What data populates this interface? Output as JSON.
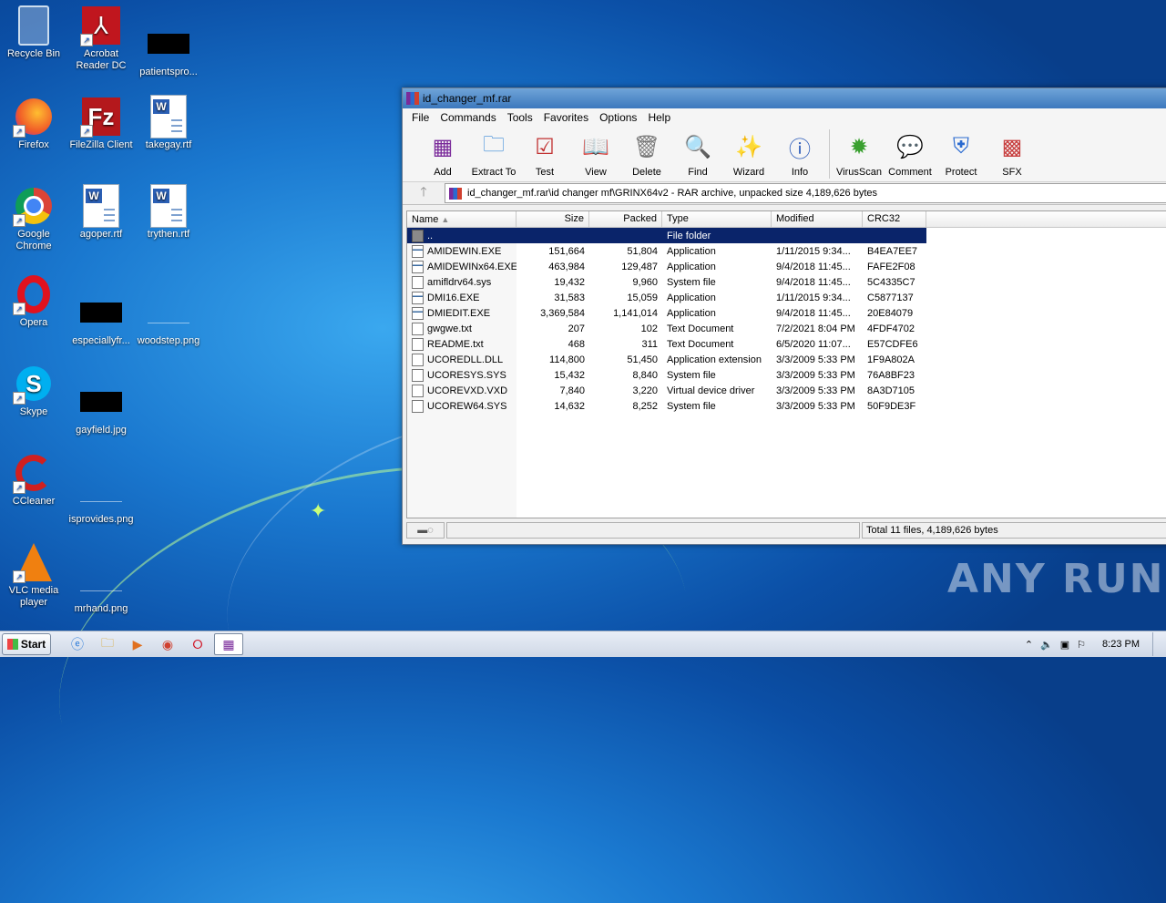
{
  "desktop_icons": [
    {
      "label": "Recycle Bin",
      "icon": "recycle-bin-icon"
    },
    {
      "label": "Acrobat\nReader DC",
      "icon": "acrobat-icon"
    },
    {
      "label": "patientspro...",
      "icon": "redacted-file-icon"
    },
    {
      "label": "Firefox",
      "icon": "firefox-icon"
    },
    {
      "label": "FileZilla Client",
      "icon": "filezilla-icon"
    },
    {
      "label": "takegay.rtf",
      "icon": "word-doc-icon"
    },
    {
      "label": "Google\nChrome",
      "icon": "chrome-icon"
    },
    {
      "label": "agoper.rtf",
      "icon": "word-doc-icon"
    },
    {
      "label": "trythen.rtf",
      "icon": "word-doc-icon"
    },
    {
      "label": "Opera",
      "icon": "opera-icon"
    },
    {
      "label": "especiallyfr...",
      "icon": "redacted-file-icon"
    },
    {
      "label": "woodstep.png",
      "icon": "image-file-icon"
    },
    {
      "label": "Skype",
      "icon": "skype-icon"
    },
    {
      "label": "gayfield.jpg",
      "icon": "redacted-file-icon"
    },
    {
      "label": "CCleaner",
      "icon": "ccleaner-icon"
    },
    {
      "label": "isprovides.png",
      "icon": "image-file-icon"
    },
    {
      "label": "VLC media\nplayer",
      "icon": "vlc-icon"
    },
    {
      "label": "mrhand.png",
      "icon": "image-file-icon"
    }
  ],
  "window": {
    "title": "id_changer_mf.rar",
    "menu": [
      "File",
      "Commands",
      "Tools",
      "Favorites",
      "Options",
      "Help"
    ],
    "toolbar": [
      "Add",
      "Extract To",
      "Test",
      "View",
      "Delete",
      "Find",
      "Wizard",
      "Info",
      "VirusScan",
      "Comment",
      "Protect",
      "SFX"
    ],
    "address": "id_changer_mf.rar\\id changer mf\\GRINX64v2 - RAR archive, unpacked size 4,189,626 bytes",
    "columns": [
      "Name",
      "Size",
      "Packed",
      "Type",
      "Modified",
      "CRC32"
    ],
    "files": [
      {
        "name": "..",
        "size": "",
        "packed": "",
        "type": "File folder",
        "modified": "",
        "crc": "",
        "kind": "folder"
      },
      {
        "name": "AMIDEWIN.EXE",
        "size": "151,664",
        "packed": "51,804",
        "type": "Application",
        "modified": "1/11/2015 9:34...",
        "crc": "B4EA7EE7",
        "kind": "app"
      },
      {
        "name": "AMIDEWINx64.EXE",
        "size": "463,984",
        "packed": "129,487",
        "type": "Application",
        "modified": "9/4/2018 11:45...",
        "crc": "FAFE2F08",
        "kind": "app"
      },
      {
        "name": "amifldrv64.sys",
        "size": "19,432",
        "packed": "9,960",
        "type": "System file",
        "modified": "9/4/2018 11:45...",
        "crc": "5C4335C7",
        "kind": "sys"
      },
      {
        "name": "DMI16.EXE",
        "size": "31,583",
        "packed": "15,059",
        "type": "Application",
        "modified": "1/11/2015 9:34...",
        "crc": "C5877137",
        "kind": "app"
      },
      {
        "name": "DMIEDIT.EXE",
        "size": "3,369,584",
        "packed": "1,141,014",
        "type": "Application",
        "modified": "9/4/2018 11:45...",
        "crc": "20E84079",
        "kind": "app"
      },
      {
        "name": "gwgwe.txt",
        "size": "207",
        "packed": "102",
        "type": "Text Document",
        "modified": "7/2/2021 8:04 PM",
        "crc": "4FDF4702",
        "kind": "txt"
      },
      {
        "name": "README.txt",
        "size": "468",
        "packed": "311",
        "type": "Text Document",
        "modified": "6/5/2020 11:07...",
        "crc": "E57CDFE6",
        "kind": "txt"
      },
      {
        "name": "UCOREDLL.DLL",
        "size": "114,800",
        "packed": "51,450",
        "type": "Application extension",
        "modified": "3/3/2009 5:33 PM",
        "crc": "1F9A802A",
        "kind": "sys"
      },
      {
        "name": "UCORESYS.SYS",
        "size": "15,432",
        "packed": "8,840",
        "type": "System file",
        "modified": "3/3/2009 5:33 PM",
        "crc": "76A8BF23",
        "kind": "sys"
      },
      {
        "name": "UCOREVXD.VXD",
        "size": "7,840",
        "packed": "3,220",
        "type": "Virtual device driver",
        "modified": "3/3/2009 5:33 PM",
        "crc": "8A3D7105",
        "kind": "sys"
      },
      {
        "name": "UCOREW64.SYS",
        "size": "14,632",
        "packed": "8,252",
        "type": "System file",
        "modified": "3/3/2009 5:33 PM",
        "crc": "50F9DE3F",
        "kind": "sys"
      }
    ],
    "status": "Total 11 files, 4,189,626 bytes"
  },
  "taskbar": {
    "start_label": "Start",
    "clock": "8:23 PM"
  },
  "watermark": "ANY RUN"
}
